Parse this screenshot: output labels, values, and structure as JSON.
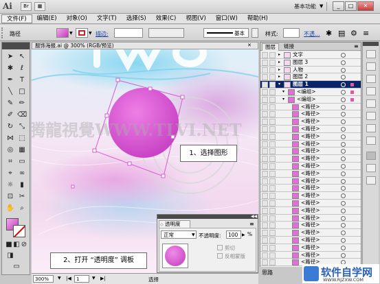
{
  "app": {
    "logo": "Ai",
    "workspace": "基本功能"
  },
  "menu": [
    "文件(F)",
    "编辑(E)",
    "对象(O)",
    "文字(T)",
    "选择(S)",
    "效果(C)",
    "视图(V)",
    "窗口(W)",
    "帮助(H)"
  ],
  "control": {
    "selection_label": "路径",
    "stroke_label": "描边:",
    "stroke_style": "基本",
    "style_label": "样式:",
    "opacity_label": "不透..."
  },
  "document": {
    "tab": "服饰海报.ai @ 300% (RGB/预览)",
    "zoom": "300%",
    "page": "1",
    "status_left": "选择",
    "status_right": "思路"
  },
  "canvas": {
    "watermark": "腾龍視覺WWW.TLVI.NET"
  },
  "callouts": {
    "step1": "1、选择图形",
    "step2": "2、打开 “透明度” 调板"
  },
  "layers_panel": {
    "tabs": [
      "图层",
      "链接"
    ],
    "rows": [
      {
        "name": "文字",
        "level": 0,
        "selected": false
      },
      {
        "name": "图层 3",
        "level": 0,
        "selected": false
      },
      {
        "name": "人物",
        "level": 0,
        "selected": false
      },
      {
        "name": "图层 2",
        "level": 0,
        "selected": false
      },
      {
        "name": "图层 1",
        "level": 0,
        "selected": true
      },
      {
        "name": "<编组>",
        "level": 1,
        "selected": false
      },
      {
        "name": "<编组>",
        "level": 1,
        "selected": false
      },
      {
        "name": "<路径>",
        "level": 2,
        "selected": false
      },
      {
        "name": "<路径>",
        "level": 2,
        "selected": false
      },
      {
        "name": "<路径>",
        "level": 2,
        "selected": false
      },
      {
        "name": "<路径>",
        "level": 2,
        "selected": false
      },
      {
        "name": "<路径>",
        "level": 2,
        "selected": false
      },
      {
        "name": "<路径>",
        "level": 2,
        "selected": false
      },
      {
        "name": "<路径>",
        "level": 2,
        "selected": false
      },
      {
        "name": "<路径>",
        "level": 2,
        "selected": false
      },
      {
        "name": "<路径>",
        "level": 2,
        "selected": false
      },
      {
        "name": "<路径>",
        "level": 2,
        "selected": false
      },
      {
        "name": "<路径>",
        "level": 2,
        "selected": false
      },
      {
        "name": "<路径>",
        "level": 2,
        "selected": false
      },
      {
        "name": "<路径>",
        "level": 2,
        "selected": false
      },
      {
        "name": "<路径>",
        "level": 2,
        "selected": false
      },
      {
        "name": "<路径>",
        "level": 2,
        "selected": false
      },
      {
        "name": "<路径>",
        "level": 2,
        "selected": false
      },
      {
        "name": "<路径>",
        "level": 2,
        "selected": false
      },
      {
        "name": "<路径>",
        "level": 2,
        "selected": false
      },
      {
        "name": "<路径>",
        "level": 2,
        "selected": false
      },
      {
        "name": "<路径>",
        "level": 2,
        "selected": false
      },
      {
        "name": "<路径>",
        "level": 2,
        "selected": false
      },
      {
        "name": "<路径>",
        "level": 2,
        "selected": false
      },
      {
        "name": "<路径>",
        "level": 2,
        "selected": false
      }
    ]
  },
  "transparency_panel": {
    "title": "透明度",
    "blend_mode": "正常",
    "opacity_label": "不透明度:",
    "opacity_value": "100",
    "opacity_unit": "%",
    "clip_label": "剪切",
    "invert_label": "反相蒙版"
  },
  "brand": {
    "text": "软件自学网",
    "url": "WWW.RJZXW.COM"
  },
  "colors": {
    "accent": "#d946d0",
    "selection": "#0a246a"
  }
}
